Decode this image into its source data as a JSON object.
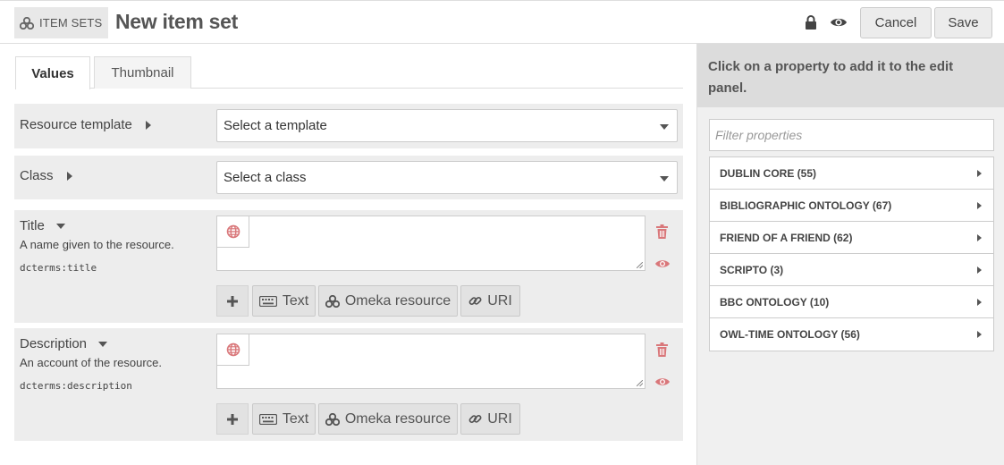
{
  "header": {
    "breadcrumb_label": "ITEM SETS",
    "title": "New item set",
    "cancel_label": "Cancel",
    "save_label": "Save"
  },
  "tabs": [
    {
      "label": "Values",
      "active": true
    },
    {
      "label": "Thumbnail",
      "active": false
    }
  ],
  "resource_template": {
    "label": "Resource template",
    "value": "Select a template"
  },
  "resource_class": {
    "label": "Class",
    "value": "Select a class"
  },
  "properties": [
    {
      "label": "Title",
      "description": "A name given to the resource.",
      "term": "dcterms:title",
      "value": ""
    },
    {
      "label": "Description",
      "description": "An account of the resource.",
      "term": "dcterms:description",
      "value": ""
    }
  ],
  "value_buttons": {
    "text": "Text",
    "omeka_resource": "Omeka resource",
    "uri": "URI"
  },
  "sidebar": {
    "heading": "Click on a property to add it to the edit panel.",
    "filter_placeholder": "Filter properties",
    "vocabularies": [
      "DUBLIN CORE (55)",
      "BIBLIOGRAPHIC ONTOLOGY (67)",
      "FRIEND OF A FRIEND (62)",
      "SCRIPTO (3)",
      "BBC ONTOLOGY (10)",
      "OWL-TIME ONTOLOGY (56)"
    ]
  },
  "colors": {
    "danger_icon": "#d9777a",
    "panel_bg": "#ededed",
    "sidebar_header_bg": "#dcdcdc"
  }
}
